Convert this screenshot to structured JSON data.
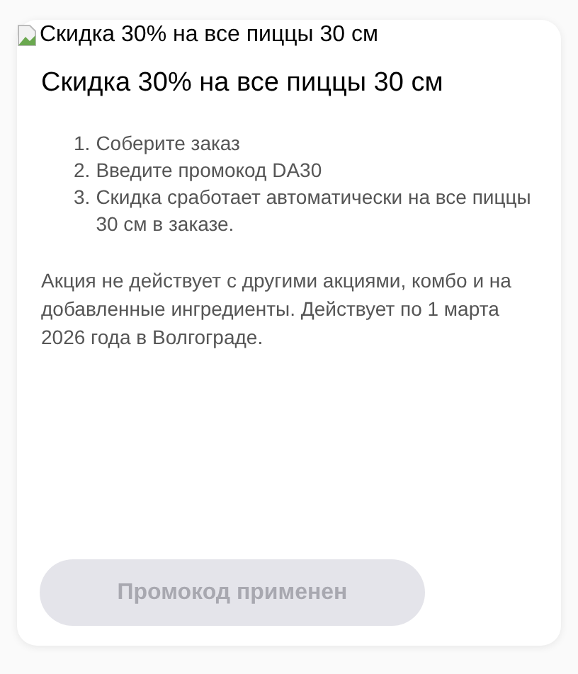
{
  "image_alt": "Скидка 30% на все пиццы 30 см",
  "title": "Скидка 30% на все пиццы 30 см",
  "steps": [
    {
      "marker": "1.",
      "text": "Соберите заказ"
    },
    {
      "marker": "2.",
      "text": "Введите промокод DA30"
    },
    {
      "marker": "3.",
      "text": "Скидка сработает автоматически на все пиццы 30 см в заказе."
    }
  ],
  "note": "Акция не действует с другими акциями, комбо и на добавленные ингредиенты. Действует по 1 марта 2026 года в Волгограде.",
  "button": {
    "label": "Промокод применен",
    "disabled": true
  }
}
